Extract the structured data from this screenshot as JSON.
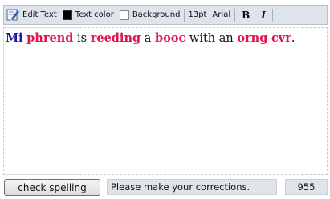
{
  "toolbar": {
    "edit_text_label": "Edit Text",
    "text_color_label": "Text color",
    "background_label": "Background",
    "font_size": "13pt",
    "font_name": "Arial",
    "bold_label": "B",
    "italic_label": "I",
    "text_color_value": "#000000",
    "background_value": "#ffffff"
  },
  "editor": {
    "words": [
      {
        "text": "Mi",
        "style": "blue"
      },
      {
        "text": " ",
        "style": "plain"
      },
      {
        "text": "phrend",
        "style": "error"
      },
      {
        "text": " is ",
        "style": "plain"
      },
      {
        "text": "reeding",
        "style": "error"
      },
      {
        "text": " a ",
        "style": "plain"
      },
      {
        "text": "booc",
        "style": "error"
      },
      {
        "text": " with an ",
        "style": "plain"
      },
      {
        "text": "orng",
        "style": "error"
      },
      {
        "text": " ",
        "style": "plain"
      },
      {
        "text": "cvr",
        "style": "error"
      },
      {
        "text": ".",
        "style": "plain"
      }
    ],
    "error_color": "#e0144c",
    "highlight_color": "#1a1aa8"
  },
  "footer": {
    "check_button_label": "check spelling",
    "status_text": "Please make your corrections.",
    "counter": "955"
  }
}
